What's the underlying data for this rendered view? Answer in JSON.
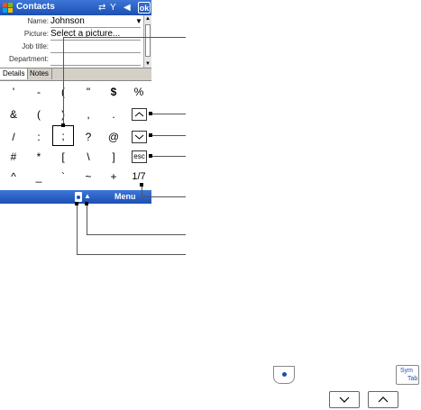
{
  "titlebar": {
    "title": "Contacts",
    "icons": [
      "connectivity-icon",
      "signal-icon",
      "volume-icon"
    ],
    "ok_label": "ok"
  },
  "form": {
    "fields": [
      {
        "label": "Name:",
        "value": "Johnson"
      },
      {
        "label": "Picture:",
        "value": "Select a picture..."
      },
      {
        "label": "Job title:",
        "value": ""
      },
      {
        "label": "Department:",
        "value": ""
      }
    ]
  },
  "tabs": [
    {
      "label": "Details",
      "active": true
    },
    {
      "label": "Notes",
      "active": false
    }
  ],
  "keyboard": {
    "rows": [
      [
        "'",
        "-",
        "(",
        "\"",
        "$",
        "%"
      ],
      [
        "&",
        "(",
        ")",
        ",",
        "."
      ],
      [
        "/",
        ":",
        ";",
        "?",
        "@"
      ],
      [
        "#",
        "*",
        "[",
        "\\",
        "]"
      ],
      [
        "^",
        "_",
        "`",
        "~",
        "+"
      ]
    ],
    "selected_key": ";",
    "page_indicator": "1/7",
    "buttons": {
      "up": "up-arrow-icon",
      "down": "down-arrow-icon",
      "esc": "esc"
    }
  },
  "menubar": {
    "menu_label": "Menu"
  },
  "legend": {
    "symtab_line1": "Sym",
    "symtab_line2": "Tab"
  }
}
